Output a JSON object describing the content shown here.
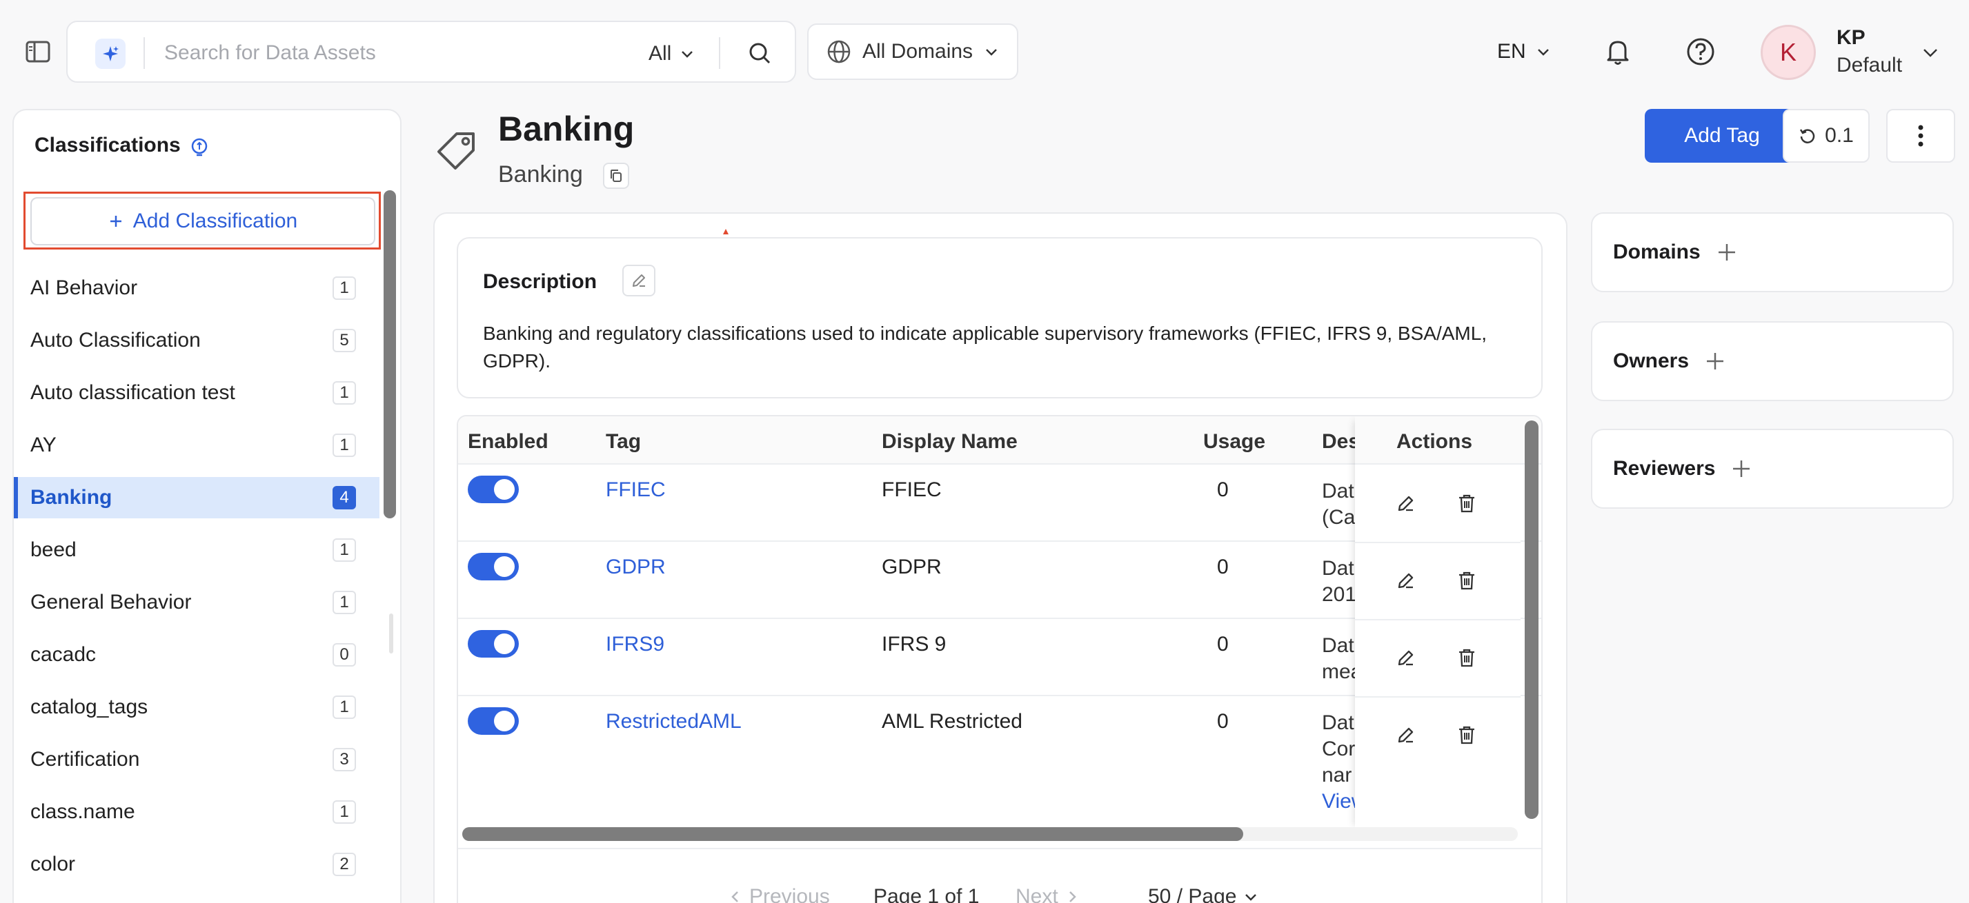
{
  "navbar": {
    "search_placeholder": "Search for Data Assets",
    "search_filter": "All",
    "domain_label": "All Domains",
    "language": "EN",
    "user": {
      "initial": "K",
      "name": "KP",
      "role": "Default"
    }
  },
  "sidebar": {
    "title": "Classifications",
    "add_button": "Add Classification",
    "items": [
      {
        "label": "AI Behavior",
        "count": "1"
      },
      {
        "label": "Auto Classification",
        "count": "5"
      },
      {
        "label": "Auto classification test",
        "count": "1"
      },
      {
        "label": "AY",
        "count": "1"
      },
      {
        "label": "Banking",
        "count": "4"
      },
      {
        "label": "beed",
        "count": "1"
      },
      {
        "label": "General Behavior",
        "count": "1"
      },
      {
        "label": "cacadc",
        "count": "0"
      },
      {
        "label": "catalog_tags",
        "count": "1"
      },
      {
        "label": "Certification",
        "count": "3"
      },
      {
        "label": "class.name",
        "count": "1"
      },
      {
        "label": "color",
        "count": "2"
      }
    ]
  },
  "header": {
    "title": "Banking",
    "subtitle": "Banking",
    "add_tag": "Add Tag",
    "version": "0.1"
  },
  "description": {
    "title": "Description",
    "text": "Banking and regulatory classifications used to indicate applicable supervisory frameworks (FFIEC, IFRS 9, BSA/AML, GDPR)."
  },
  "table": {
    "columns": {
      "enabled": "Enabled",
      "tag": "Tag",
      "display_name": "Display Name",
      "usage": "Usage",
      "description": "Des",
      "actions": "Actions"
    },
    "rows": [
      {
        "tag": "FFIEC",
        "display_name": "FFIEC",
        "usage": "0",
        "desc_line1": "Dat",
        "desc_line2": "(Ca"
      },
      {
        "tag": "GDPR",
        "display_name": "GDPR",
        "usage": "0",
        "desc_line1": "Dat",
        "desc_line2": "201"
      },
      {
        "tag": "IFRS9",
        "display_name": "IFRS 9",
        "usage": "0",
        "desc_line1": "Dat",
        "desc_line2": "mea"
      },
      {
        "tag": "RestrictedAML",
        "display_name": "AML Restricted",
        "usage": "0",
        "desc_line1": "Dat",
        "desc_line2": "Cor",
        "desc_line3": "nar",
        "desc_view": "View"
      }
    ]
  },
  "pagination": {
    "previous": "Previous",
    "page_info": "Page 1 of 1",
    "next": "Next",
    "page_size": "50 / Page"
  },
  "right_panel": {
    "domains": "Domains",
    "owners": "Owners",
    "reviewers": "Reviewers"
  },
  "colors": {
    "primary": "#2f63e0",
    "highlight_outline": "#e24b30",
    "active_item_bg": "#dbe8fc"
  }
}
